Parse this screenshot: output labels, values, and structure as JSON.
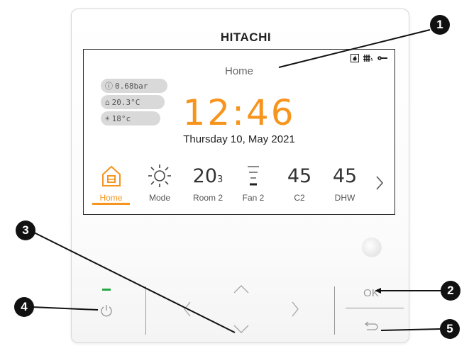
{
  "brand": "HITACHI",
  "screen": {
    "title": "Home",
    "status_icons": [
      "flame-icon",
      "radiator-icon",
      "wrench-icon"
    ],
    "pills": [
      {
        "icon": "pressure-icon",
        "text": "0.68bar"
      },
      {
        "icon": "house-temp-icon",
        "text": "20.3°C"
      },
      {
        "icon": "outdoor-temp-icon",
        "text": "18°c"
      }
    ],
    "clock": "12:46",
    "date": "Thursday 10, May 2021",
    "menu": {
      "home": {
        "label": "Home"
      },
      "mode": {
        "label": "Mode"
      },
      "room2": {
        "value": "20",
        "decimal": "3",
        "label": "Room 2"
      },
      "fan2": {
        "label": "Fan 2"
      },
      "c2": {
        "value": "45",
        "label": "C2"
      },
      "dhw": {
        "value": "45",
        "label": "DHW"
      }
    }
  },
  "buttons": {
    "ok": "OK"
  },
  "callouts": [
    "1",
    "2",
    "3",
    "4",
    "5"
  ],
  "colors": {
    "accent": "#f7941d",
    "led": "#27a844"
  }
}
